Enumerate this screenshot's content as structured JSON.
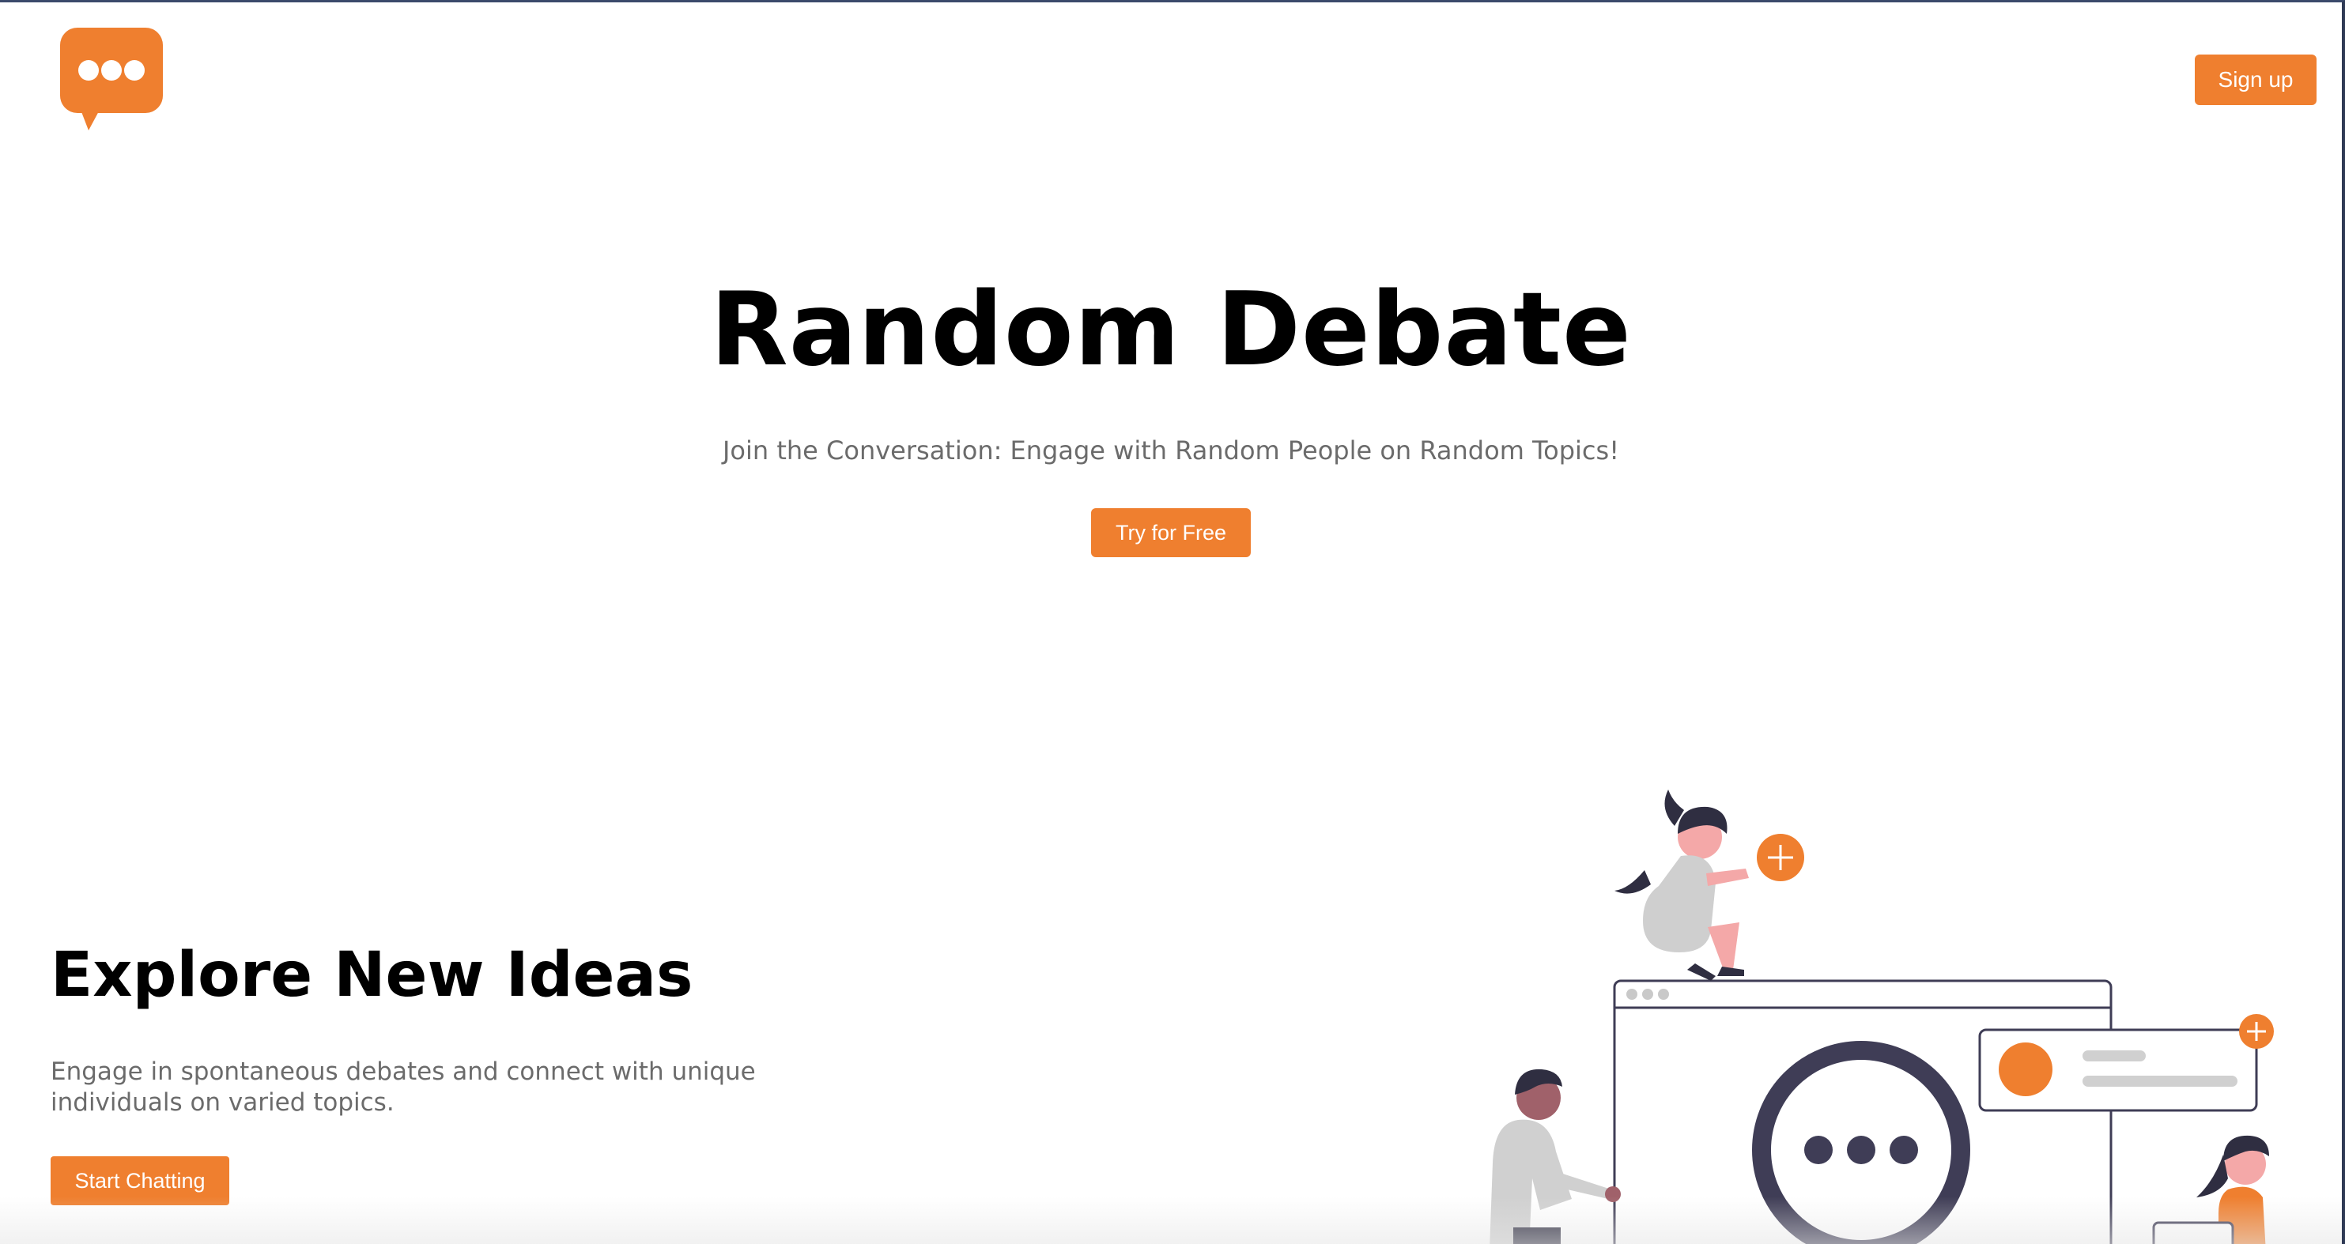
{
  "header": {
    "logo_icon": "chat-bubble-icon",
    "signup_label": "Sign up"
  },
  "hero": {
    "title": "Random Debate",
    "subtitle": "Join the Conversation: Engage with Random People on Random Topics!",
    "cta_label": "Try for Free"
  },
  "feature": {
    "title": "Explore New Ideas",
    "description": "Engage in spontaneous debates and connect with unique individuals on varied topics.",
    "cta_label": "Start Chatting",
    "illustration_icon": "people-chatting-illustration"
  },
  "colors": {
    "accent": "#ef7f2f",
    "dark": "#3f3d56",
    "muted_text": "#6b6b6b"
  }
}
